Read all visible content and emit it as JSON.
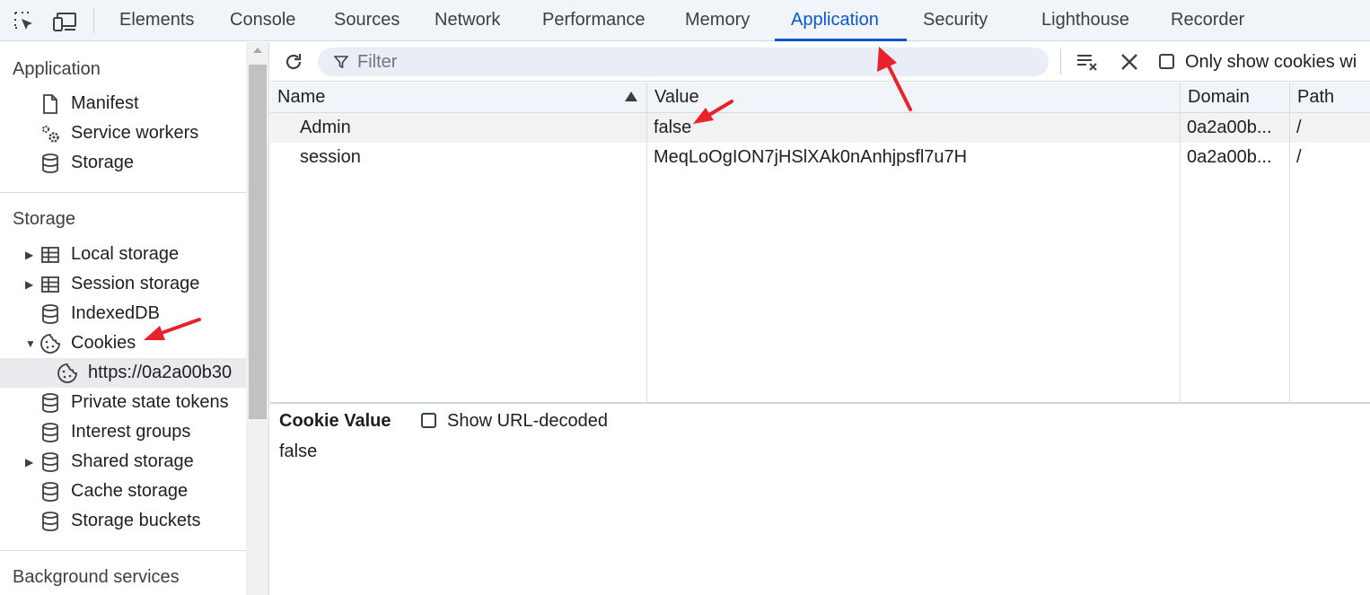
{
  "devtools_tabs": [
    "Elements",
    "Console",
    "Sources",
    "Network",
    "Performance",
    "Memory",
    "Application",
    "Security",
    "Lighthouse",
    "Recorder"
  ],
  "active_tab": "Application",
  "sidebar": {
    "application_title": "Application",
    "application_items": [
      "Manifest",
      "Service workers",
      "Storage"
    ],
    "storage_title": "Storage",
    "storage_items": {
      "local_storage": "Local storage",
      "session_storage": "Session storage",
      "indexeddb": "IndexedDB",
      "cookies": "Cookies",
      "cookie_origin": "https://0a2a00b30",
      "private_state_tokens": "Private state tokens",
      "interest_groups": "Interest groups",
      "shared_storage": "Shared storage",
      "cache_storage": "Cache storage",
      "storage_buckets": "Storage buckets"
    },
    "background_title": "Background services"
  },
  "toolbar": {
    "filter_placeholder": "Filter",
    "only_show_label": "Only show cookies wi"
  },
  "table": {
    "columns": [
      "Name",
      "Value",
      "Domain",
      "Path"
    ],
    "rows": [
      {
        "name": "Admin",
        "value": "false",
        "domain": "0a2a00b...",
        "path": "/"
      },
      {
        "name": "session",
        "value": "MeqLoOgION7jHSlXAk0nAnhjpsfl7u7H",
        "domain": "0a2a00b...",
        "path": "/"
      }
    ]
  },
  "detail": {
    "title": "Cookie Value",
    "show_decoded_label": "Show URL-decoded",
    "value": "false"
  },
  "colors": {
    "accent": "#0b57d0",
    "annotation": "#e8222a"
  }
}
